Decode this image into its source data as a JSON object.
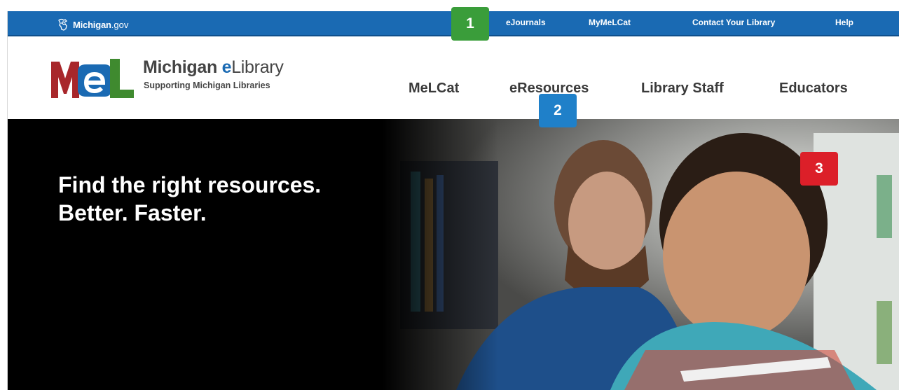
{
  "topbar": {
    "logo_text": "Michigan",
    "logo_suffix": ".gov",
    "links": [
      "eJournals",
      "MyMeLCat",
      "Contact Your Library",
      "Help"
    ]
  },
  "header": {
    "logo_letters": "MeL",
    "brand_name_1": "Michigan ",
    "brand_name_e": "e",
    "brand_name_2": "Library",
    "brand_subtitle": "Supporting Michigan Libraries",
    "nav": [
      "MeLCat",
      "eResources",
      "Library Staff",
      "Educators"
    ]
  },
  "hero": {
    "line1": "Find the right resources.",
    "line2": "Better. Faster."
  },
  "callouts": [
    "1",
    "2",
    "3"
  ],
  "colors": {
    "topbar": "#1a6ab3",
    "mel_red": "#a8272b",
    "mel_blue": "#1a6ab3",
    "mel_green": "#3f8a2f",
    "badge_green": "#3a9d3a",
    "badge_blue": "#1f80c9",
    "badge_red": "#dc1f29"
  }
}
